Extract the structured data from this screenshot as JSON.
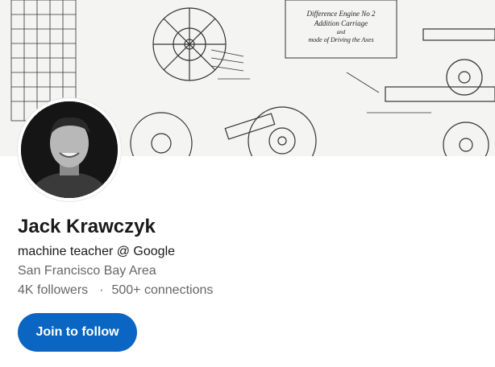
{
  "cover": {
    "image": "difference-engine-blueprint-illustration",
    "caption_lines": [
      "Difference Engine No 2",
      "Addition Carriage",
      "and",
      "mode of Driving the Axes"
    ]
  },
  "profile": {
    "photo": "profile-photo",
    "name": "Jack Krawczyk",
    "headline": "machine teacher @ Google",
    "location": "San Francisco Bay Area",
    "followers": "4K followers",
    "separator": "·",
    "connections": "500+ connections"
  },
  "actions": {
    "follow_label": "Join to follow"
  },
  "colors": {
    "accent": "#0a66c2",
    "secondary_text": "#666666"
  }
}
